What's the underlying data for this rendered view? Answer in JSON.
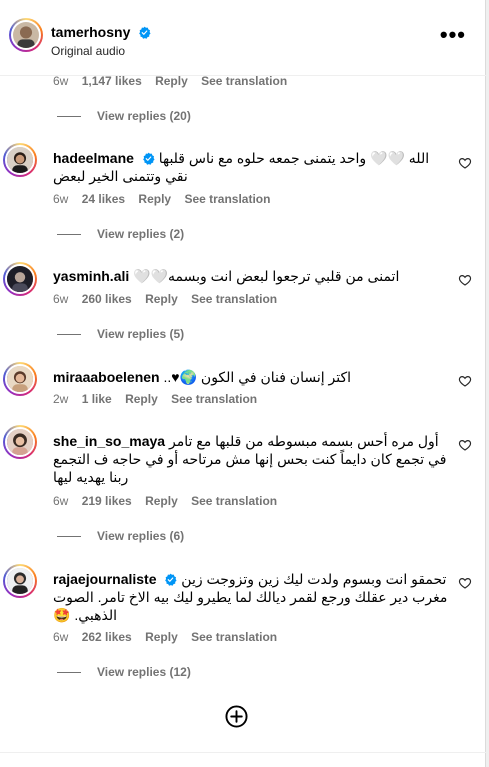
{
  "header": {
    "username": "tamerhosny",
    "subtitle": "Original audio",
    "more_label": "•••"
  },
  "top_meta": {
    "age": "6w",
    "likes": "1,147 likes",
    "reply": "Reply",
    "translate": "See translation"
  },
  "top_replies": "View replies (20)",
  "comments": [
    {
      "author": "hadeelmane",
      "verified": true,
      "text": "الله 🤍🤍 واحد يتمنى جمعه حلوه مع ناس قلبها نقي وتتمنى الخير لبعض",
      "age": "6w",
      "likes": "24 likes",
      "reply": "Reply",
      "translate": "See translation",
      "replies": "View replies (2)"
    },
    {
      "author": "yasminh.ali",
      "verified": false,
      "text": "اتمنى من قلبي ترجعوا لبعض انت وبسمه🤍🤍",
      "age": "6w",
      "likes": "260 likes",
      "reply": "Reply",
      "translate": "See translation",
      "replies": "View replies (5)"
    },
    {
      "author": "miraaaboelenen",
      "verified": false,
      "text": "اكتر إنسان فنان في الكون 🌍♥..",
      "age": "2w",
      "likes": "1 like",
      "reply": "Reply",
      "translate": "See translation",
      "replies": ""
    },
    {
      "author": "she_in_so_maya",
      "verified": false,
      "text": "أول مره أحس بسمه مبسوطه من قلبها مع تامر في تجمع كان دايماً كنت بحس إنها مش مرتاحه أو في حاجه ف التجمع ربنا يهديه ليها",
      "age": "6w",
      "likes": "219 likes",
      "reply": "Reply",
      "translate": "See translation",
      "replies": "View replies (6)"
    },
    {
      "author": "rajaejournaliste",
      "verified": true,
      "text": "تحمقو انت وبسوم ولدت ليك زين وتزوجت زين مغرب دير عقلك ورجع لقمر ديالك لما يطيرو ليك بيه الاخ تامر. الصوت الذهبي. 🤩",
      "age": "6w",
      "likes": "262 likes",
      "reply": "Reply",
      "translate": "See translation",
      "replies": "View replies (12)"
    }
  ],
  "colors": {
    "verified": "#0095f6",
    "muted": "#737373",
    "divider": "#efefef"
  },
  "icons": [
    "verified-badge-icon",
    "heart-icon",
    "more-icon",
    "add-comment-icon"
  ]
}
